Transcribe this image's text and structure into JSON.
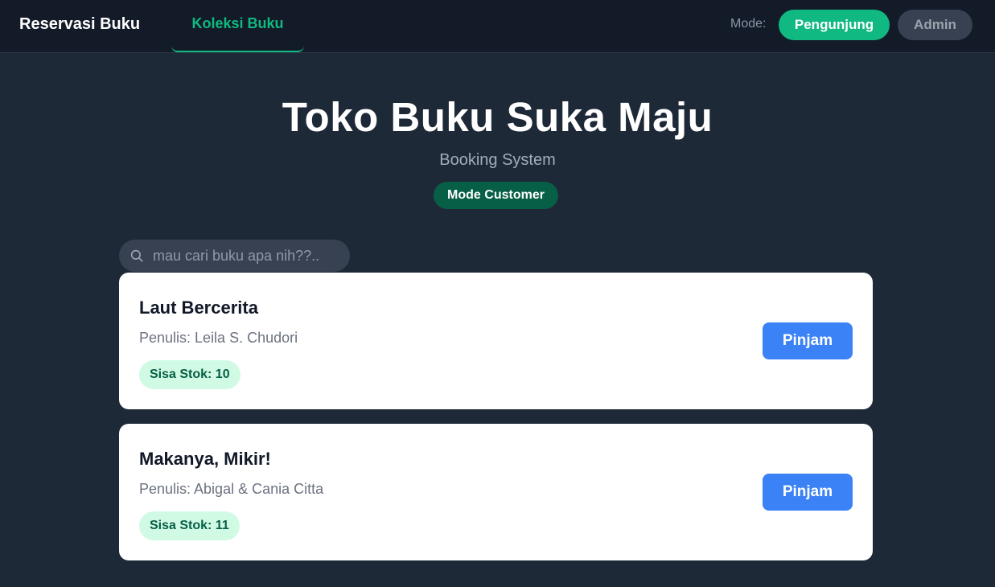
{
  "header": {
    "brand": "Reservasi Buku",
    "nav_tab": "Koleksi Buku",
    "mode_label": "Mode:",
    "mode_visitor": "Pengunjung",
    "mode_admin": "Admin"
  },
  "hero": {
    "title": "Toko Buku Suka Maju",
    "subtitle": "Booking System",
    "mode_badge": "Mode Customer"
  },
  "search": {
    "placeholder": "mau cari buku apa nih??..",
    "value": ""
  },
  "books": [
    {
      "title": "Laut Bercerita",
      "author": "Penulis: Leila S. Chudori",
      "stock": "Sisa Stok: 10",
      "button": "Pinjam"
    },
    {
      "title": "Makanya, Mikir!",
      "author": "Penulis: Abigal & Cania Citta",
      "stock": "Sisa Stok: 11",
      "button": "Pinjam"
    }
  ],
  "colors": {
    "accent": "#10b981",
    "primary_button": "#3b82f6",
    "background": "#1e2938",
    "topbar": "#131a28"
  }
}
